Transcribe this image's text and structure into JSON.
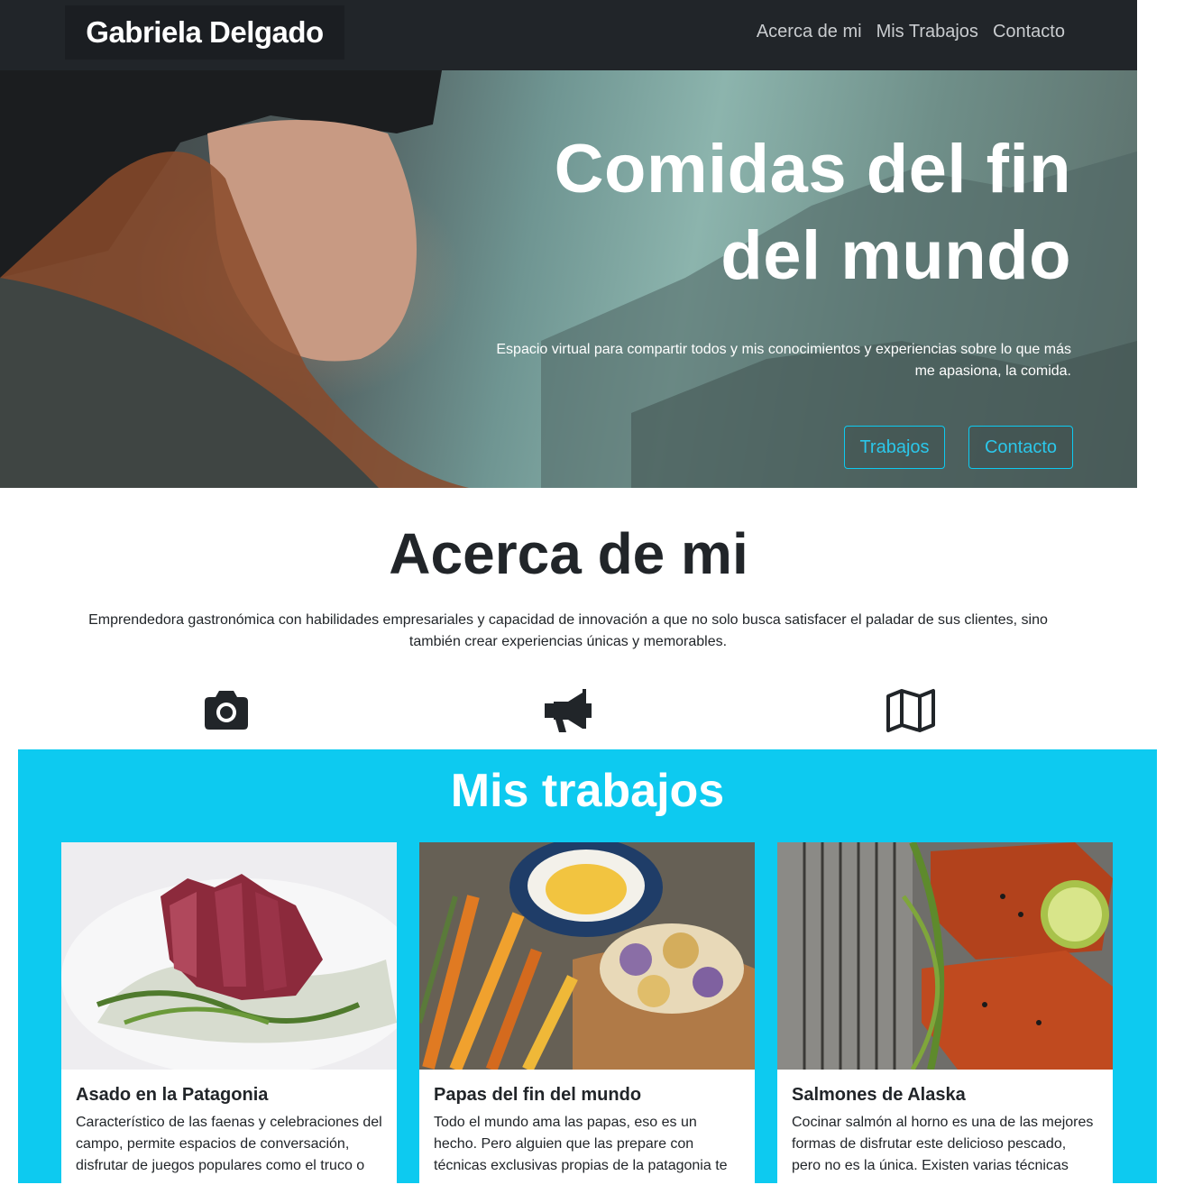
{
  "navbar": {
    "brand": "Gabriela Delgado",
    "links": [
      "Acerca de mi",
      "Mis Trabajos",
      "Contacto"
    ]
  },
  "hero": {
    "title_line1": "Comidas del fin",
    "title_line2": "del mundo",
    "subtitle": "Espacio virtual para compartir todos y mis conocimientos y experiencias sobre lo que más me apasiona, la comida.",
    "buttons": [
      "Trabajos",
      "Contacto"
    ]
  },
  "about": {
    "title": "Acerca de mi",
    "text": "Emprendedora gastronómica con habilidades empresariales y capacidad de innovación a que no solo busca satisfacer el paladar de sus clientes, sino también crear experiencias únicas y memorables.",
    "icons": [
      "camera-icon",
      "megaphone-icon",
      "map-icon"
    ]
  },
  "works": {
    "title": "Mis trabajos",
    "cards": [
      {
        "title": "Asado en la Patagonia",
        "text": "Característico de las faenas y celebraciones del campo, permite espacios de conversación, disfrutar de juegos populares como el truco o"
      },
      {
        "title": "Papas del fin del mundo",
        "text": "Todo el mundo ama las papas, eso es un hecho. Pero alguien que las prepare con técnicas exclusivas propias de la patagonia te"
      },
      {
        "title": "Salmones de Alaska",
        "text": "Cocinar salmón al horno es una de las mejores formas de disfrutar este delicioso pescado, pero no es la única. Existen varias técnicas"
      }
    ]
  },
  "colors": {
    "navbar_bg": "#212529",
    "accent": "#0dcaf0",
    "text": "#212529"
  }
}
